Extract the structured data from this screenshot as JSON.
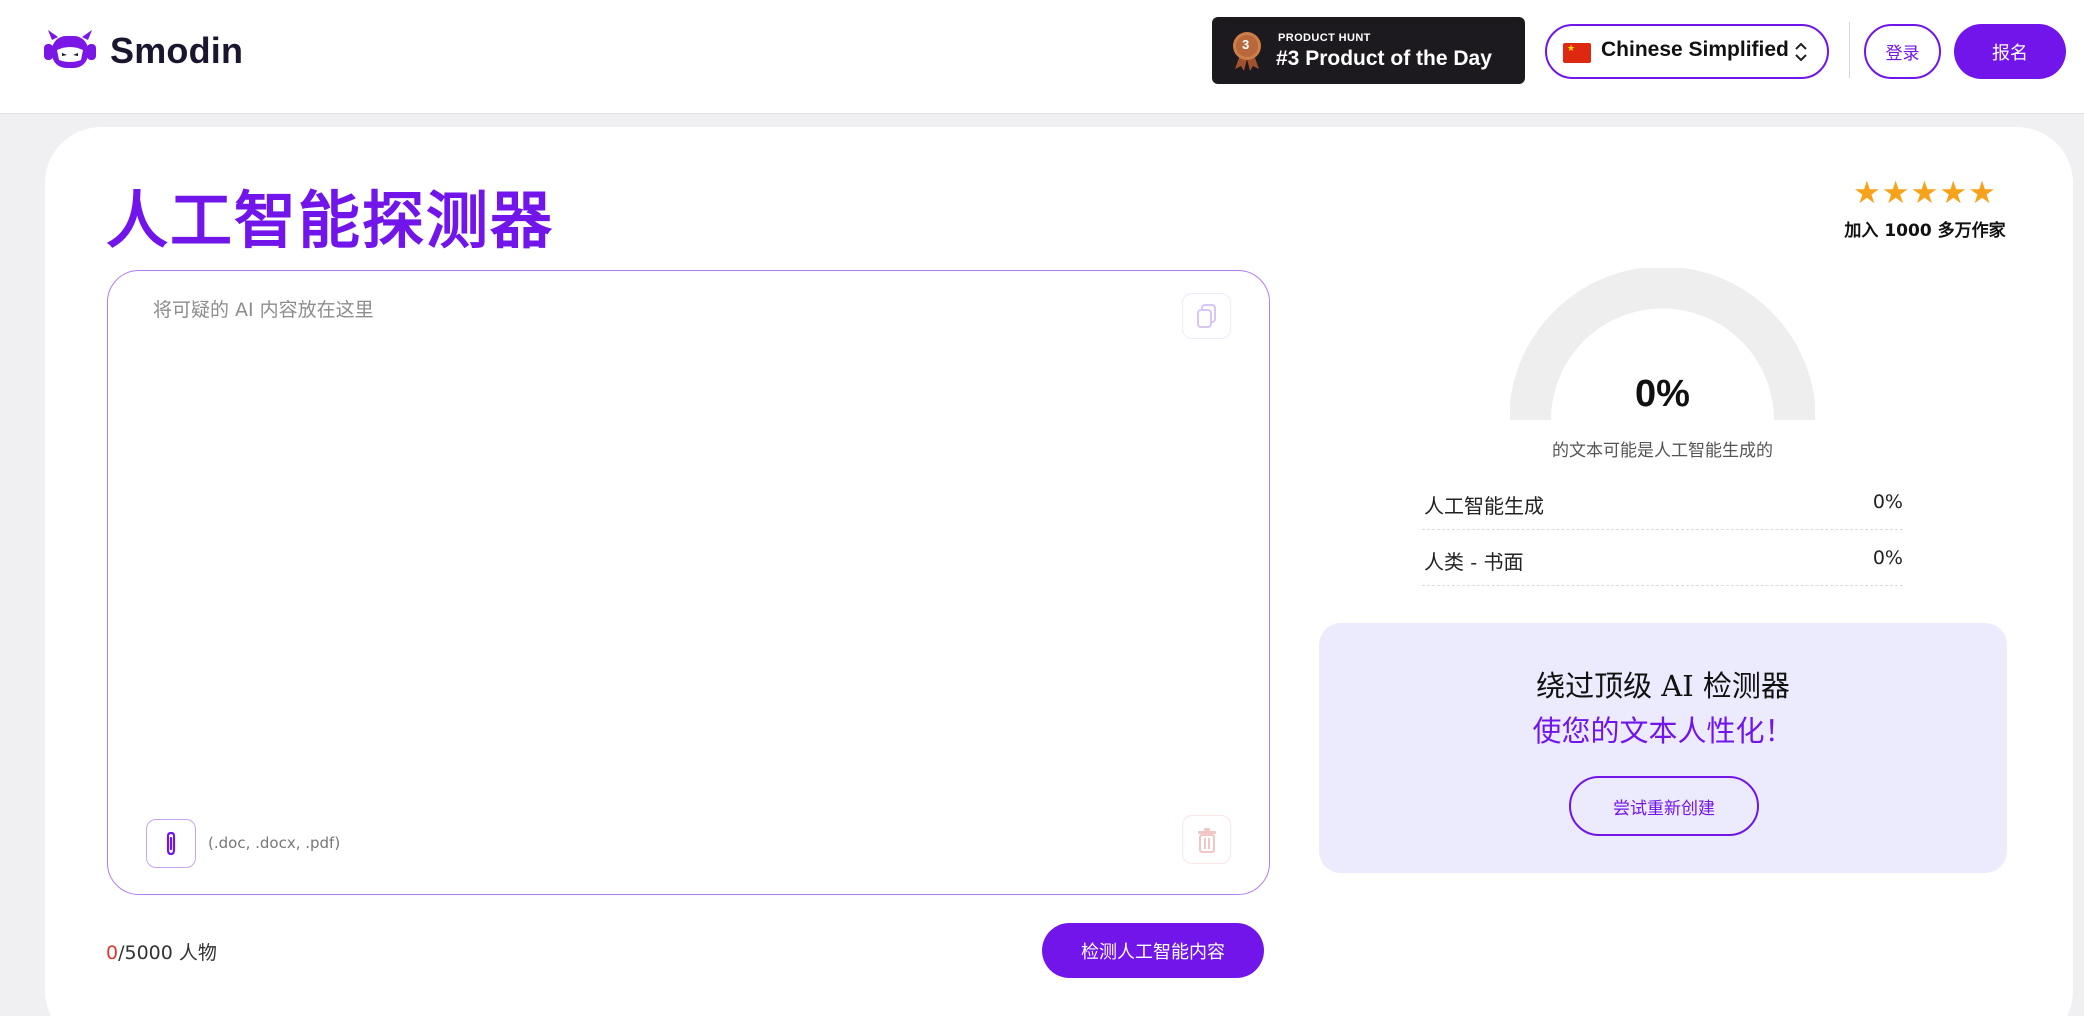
{
  "header": {
    "logo_text": "Smodin",
    "product_hunt": {
      "small_label": "PRODUCT HUNT",
      "big_label": "#3 Product of the Day",
      "rank": "3"
    },
    "language": {
      "selected": "Chinese Simplified",
      "flag": "cn-flag"
    },
    "login_label": "登录",
    "signup_label": "报名"
  },
  "main": {
    "title": "人工智能探测器",
    "rating": {
      "stars": "★★★★★",
      "label": "加入 1000 多万作家"
    },
    "editor": {
      "placeholder": "将可疑的 AI 内容放在这里",
      "file_types": "(.doc, .docx, .pdf)"
    },
    "char_count": {
      "current": "0",
      "limit": "/5000 人物"
    },
    "detect_button": "检测人工智能内容"
  },
  "result": {
    "gauge_value": "0%",
    "gauge_fraction": 0,
    "gauge_caption": "的文本可能是人工智能生成的",
    "stats": [
      {
        "label": "人工智能生成",
        "value": "0%"
      },
      {
        "label": "人类 - 书面",
        "value": "0%"
      }
    ]
  },
  "promo": {
    "line1": "绕过顶级 AI 检测器",
    "line2": "使您的文本人性化！",
    "button": "尝试重新创建"
  },
  "colors": {
    "accent": "#7115ea",
    "star": "#f7a21b",
    "promo_bg": "#ecebfd"
  }
}
